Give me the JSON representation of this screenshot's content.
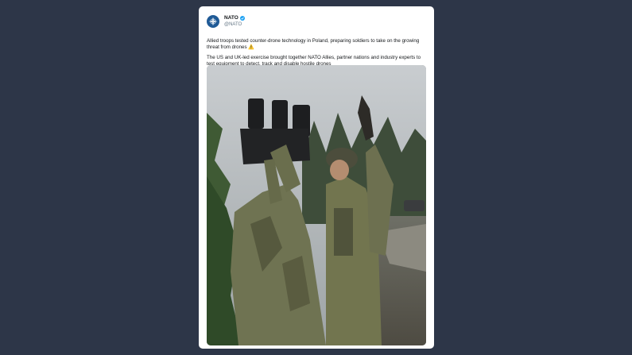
{
  "tweet": {
    "display_name": "NATO",
    "handle": "@NATO",
    "paragraph_1": "Allied troops tested counter-drone technology in Poland, preparing soldiers to take on the growing threat from drones",
    "emoji": "⚠️",
    "paragraph_2": "The US and UK-led exercise brought together NATO Allies, partner nations and industry experts to test equipment to detect, track and disable hostile drones"
  },
  "icons": {
    "avatar": "nato-compass-rose-icon",
    "verified": "verified-badge-icon"
  },
  "colors": {
    "background": "#2d3648",
    "card": "#ffffff",
    "verified": "#1da1f2",
    "avatar": "#1f5a96"
  }
}
